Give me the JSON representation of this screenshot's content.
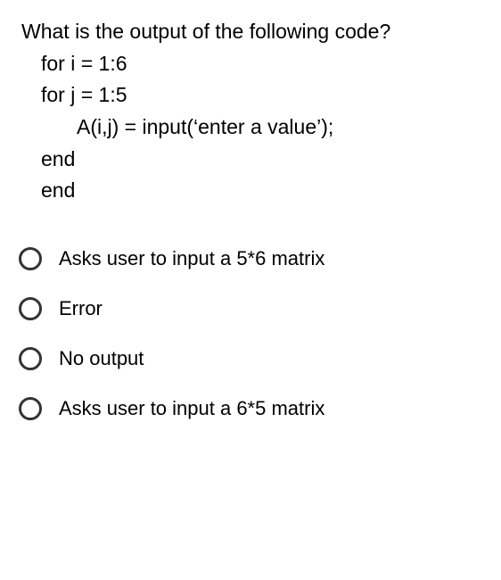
{
  "question": {
    "lines": [
      {
        "text": "What is the output of the following code?",
        "indent": 0
      },
      {
        "text": "for i = 1:6",
        "indent": 1
      },
      {
        "text": "for j = 1:5",
        "indent": 1
      },
      {
        "text": "A(i,j) = input(‘enter a value’);",
        "indent": 2
      },
      {
        "text": "end",
        "indent": 1
      },
      {
        "text": "end",
        "indent": 1
      }
    ]
  },
  "options": [
    {
      "label": "Asks user to input a 5*6 matrix",
      "selected": false
    },
    {
      "label": "Error",
      "selected": false
    },
    {
      "label": "No output",
      "selected": false
    },
    {
      "label": "Asks user to input a 6*5 matrix",
      "selected": false
    }
  ]
}
